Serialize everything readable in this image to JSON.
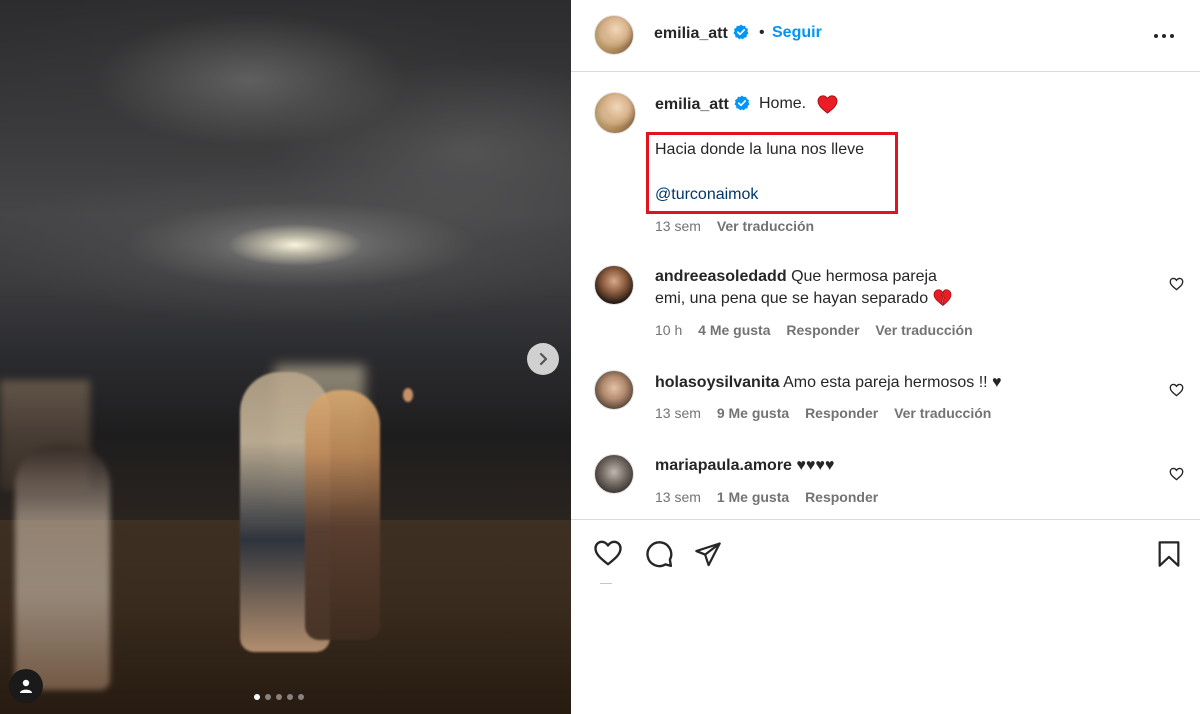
{
  "post": {
    "username": "emilia_att",
    "separator": "•",
    "follow_label": "Seguir",
    "caption_title": "Home.",
    "caption_line": "Hacia donde la luna nos lleve",
    "caption_mention": "@turconaimok",
    "caption_time": "13 sem",
    "caption_translate": "Ver traducción"
  },
  "comments": [
    {
      "username": "andreeasoledadd",
      "text": "Que hermosa pareja emi, una pena que se hayan separado",
      "emoji": "💔",
      "time": "10 h",
      "likes": "4 Me gusta",
      "reply": "Responder",
      "translate": "Ver traducción"
    },
    {
      "username": "holasoysilvanita",
      "text": "Amo esta pareja hermosos !! ♥",
      "time": "13 sem",
      "likes": "9 Me gusta",
      "reply": "Responder",
      "translate": "Ver traducción"
    },
    {
      "username": "mariapaula.amore",
      "text": "♥♥♥♥",
      "time": "13 sem",
      "likes": "1 Me gusta",
      "reply": "Responder"
    }
  ],
  "carousel": {
    "total_slides": 5,
    "active_slide": 1
  },
  "colors": {
    "follow": "#0095f6",
    "verified": "#0095f6",
    "highlight_box": "#e1131f",
    "heart_red": "#ed1c24",
    "muted_text": "#737373",
    "mention": "#00376b"
  },
  "icons": [
    "verified-badge-icon",
    "more-options-icon",
    "red-heart-icon",
    "like-icon",
    "comment-icon",
    "share-icon",
    "save-icon",
    "carousel-next-icon",
    "tagged-user-icon"
  ]
}
